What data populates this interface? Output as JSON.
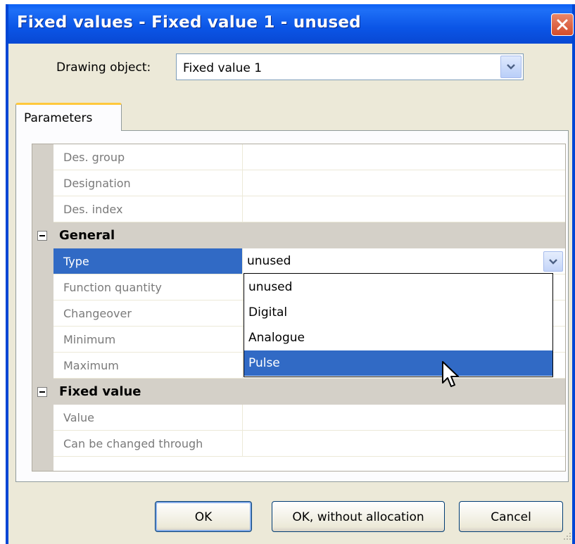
{
  "window": {
    "title": "Fixed values - Fixed value 1 - unused",
    "close_icon": "close-icon"
  },
  "drawing_object": {
    "label": "Drawing object:",
    "value": "Fixed value 1"
  },
  "tabs": [
    {
      "label": "Parameters",
      "active": true
    }
  ],
  "grid": {
    "rows_top": [
      {
        "name": "Des. group",
        "value": ""
      },
      {
        "name": "Designation",
        "value": ""
      },
      {
        "name": "Des. index",
        "value": ""
      }
    ],
    "general": {
      "label": "General",
      "rows": [
        {
          "name": "Type",
          "value": "unused"
        },
        {
          "name": "Function quantity",
          "value": ""
        },
        {
          "name": "Changeover",
          "value": ""
        },
        {
          "name": "Minimum",
          "value": ""
        },
        {
          "name": "Maximum",
          "value": ""
        }
      ]
    },
    "fixed_value": {
      "label": "Fixed value",
      "rows": [
        {
          "name": "Value",
          "value": ""
        },
        {
          "name": "Can be changed through",
          "value": ""
        }
      ]
    }
  },
  "type_dropdown": {
    "options": [
      "unused",
      "Digital",
      "Analogue",
      "Pulse"
    ],
    "highlighted": "Pulse"
  },
  "buttons": {
    "ok": "OK",
    "ok_without_allocation": "OK, without allocation",
    "cancel": "Cancel"
  },
  "colors": {
    "titlebar": "#0a5ff5",
    "selection": "#316ac5",
    "dialog_bg": "#ece9d8",
    "tab_accent": "#ffc83c"
  }
}
